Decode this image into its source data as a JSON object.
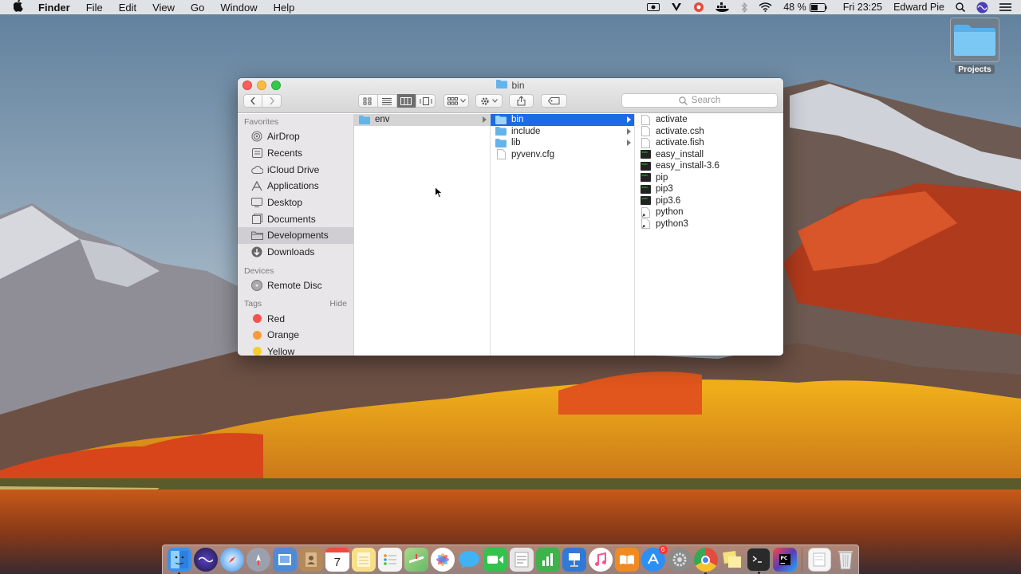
{
  "menubar": {
    "app_name": "Finder",
    "menus": [
      "File",
      "Edit",
      "View",
      "Go",
      "Window",
      "Help"
    ],
    "battery": "48 %",
    "clock": "Fri 23:25",
    "user": "Edward Pie"
  },
  "desktop": {
    "icons": [
      {
        "label": "Projects",
        "icon": "folder-icon"
      }
    ]
  },
  "window": {
    "title": "bin",
    "search_placeholder": "Search",
    "view_mode": "columns",
    "sidebar": {
      "favorites_header": "Favorites",
      "favorites": [
        {
          "label": "AirDrop",
          "icon": "airdrop-icon"
        },
        {
          "label": "Recents",
          "icon": "recents-icon"
        },
        {
          "label": "iCloud Drive",
          "icon": "cloud-icon"
        },
        {
          "label": "Applications",
          "icon": "applications-icon"
        },
        {
          "label": "Desktop",
          "icon": "desktop-icon"
        },
        {
          "label": "Documents",
          "icon": "documents-icon"
        },
        {
          "label": "Developments",
          "icon": "folder-icon",
          "selected": true
        },
        {
          "label": "Downloads",
          "icon": "downloads-icon"
        }
      ],
      "devices_header": "Devices",
      "devices": [
        {
          "label": "Remote Disc",
          "icon": "disc-icon"
        }
      ],
      "tags_header": "Tags",
      "tags_hide": "Hide",
      "tags": [
        {
          "label": "Red",
          "color": "#f4524d"
        },
        {
          "label": "Orange",
          "color": "#f89b39"
        },
        {
          "label": "Yellow",
          "color": "#f7cc2d"
        }
      ]
    },
    "columns": [
      {
        "items": [
          {
            "label": "env",
            "type": "folder",
            "has_children": true,
            "selected": "grey"
          }
        ]
      },
      {
        "items": [
          {
            "label": "bin",
            "type": "folder",
            "has_children": true,
            "selected": "blue"
          },
          {
            "label": "include",
            "type": "folder",
            "has_children": true
          },
          {
            "label": "lib",
            "type": "folder",
            "has_children": true
          },
          {
            "label": "pyvenv.cfg",
            "type": "file"
          }
        ]
      },
      {
        "items": [
          {
            "label": "activate",
            "type": "file"
          },
          {
            "label": "activate.csh",
            "type": "file"
          },
          {
            "label": "activate.fish",
            "type": "file"
          },
          {
            "label": "easy_install",
            "type": "exec"
          },
          {
            "label": "easy_install-3.6",
            "type": "exec"
          },
          {
            "label": "pip",
            "type": "exec"
          },
          {
            "label": "pip3",
            "type": "exec"
          },
          {
            "label": "pip3.6",
            "type": "exec"
          },
          {
            "label": "python",
            "type": "alias"
          },
          {
            "label": "python3",
            "type": "alias"
          }
        ]
      }
    ]
  },
  "dock": {
    "calendar_day": "7",
    "appstore_badge": "6",
    "apps": [
      {
        "name": "finder-icon",
        "color": "#3b8fe8",
        "running": true
      },
      {
        "name": "siri-icon",
        "color": "#5b3fc4"
      },
      {
        "name": "safari-icon",
        "color": "#2f8ee8"
      },
      {
        "name": "launchpad-icon",
        "color": "#8a8fa0"
      },
      {
        "name": "preview-icon",
        "color": "#4d8bd8"
      },
      {
        "name": "contacts-icon",
        "color": "#b58a5a"
      },
      {
        "name": "calendar-icon",
        "color": "#ffffff"
      },
      {
        "name": "notes-icon",
        "color": "#f8e08a"
      },
      {
        "name": "reminders-icon",
        "color": "#f4f4f4"
      },
      {
        "name": "maps-icon",
        "color": "#68b868"
      },
      {
        "name": "photos-icon",
        "color": "#f4a040"
      },
      {
        "name": "messages-icon",
        "color": "#3fb3f5"
      },
      {
        "name": "facetime-icon",
        "color": "#33c24d"
      },
      {
        "name": "textedit-icon",
        "color": "#e6e6e6"
      },
      {
        "name": "numbers-icon",
        "color": "#3eb24b"
      },
      {
        "name": "keynote-icon",
        "color": "#2f7ad8"
      },
      {
        "name": "itunes-icon",
        "color": "#f6568a"
      },
      {
        "name": "ibooks-icon",
        "color": "#f08a22"
      },
      {
        "name": "appstore-icon",
        "color": "#2c8ff5",
        "badge": true
      },
      {
        "name": "system-preferences-icon",
        "color": "#8b8b8b"
      },
      {
        "name": "chrome-icon",
        "color": "#e44b3c",
        "running": true
      },
      {
        "name": "stickies-icon",
        "color": "#f6e27b"
      },
      {
        "name": "terminal-icon",
        "color": "#2a2a2a",
        "running": true
      },
      {
        "name": "pycharm-icon",
        "color": "#5a3cb4"
      }
    ],
    "trailing": [
      {
        "name": "downloads-stack-icon",
        "color": "#f5f5f5"
      },
      {
        "name": "trash-icon",
        "color": "#d8d8d8"
      }
    ]
  }
}
